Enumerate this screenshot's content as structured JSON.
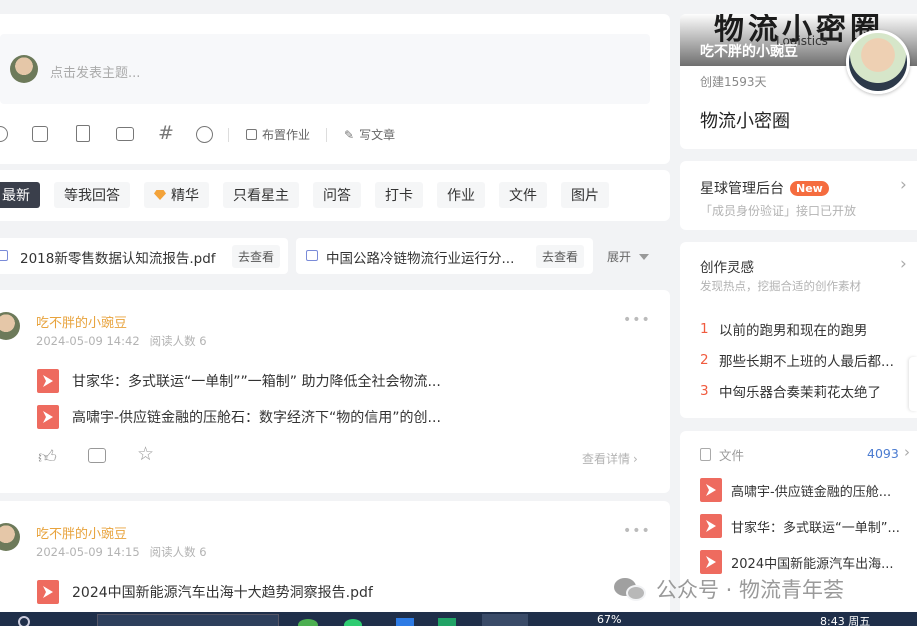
{
  "composer": {
    "placeholder": "点击发表主题...",
    "assign_label": "布置作业",
    "article_label": "写文章"
  },
  "filters": {
    "items": [
      "最新",
      "等我回答",
      "精华",
      "只看星主",
      "问答",
      "打卡",
      "作业",
      "文件",
      "图片"
    ]
  },
  "pinned": {
    "files": [
      "2018新零售数据认知流报告.pdf",
      "中国公路冷链物流行业运行分..."
    ],
    "view_label": "去查看",
    "expand_label": "展开"
  },
  "posts": [
    {
      "author": "吃不胖的小豌豆",
      "time": "2024-05-09 14:42",
      "reads": "阅读人数 6",
      "files": [
        "甘家华：多式联运“一单制””一箱制” 助力降低全社会物流...",
        "高啸宇-供应链金融的压舱石：数字经济下“物的信用”的创..."
      ],
      "detail_label": "查看详情"
    },
    {
      "author": "吃不胖的小豌豆",
      "time": "2024-05-09 14:15",
      "reads": "阅读人数 6",
      "files": [
        "2024中国新能源汽车出海十大趋势洞察报告.pdf"
      ]
    }
  ],
  "sidebar": {
    "banner_text": "物流小密圈",
    "banner_sub": "Logistics",
    "owner": "吃不胖的小豌豆",
    "created": "创建1593天",
    "group_name": "物流小密圈",
    "admin": {
      "title": "星球管理后台",
      "badge": "New",
      "sub": "「成员身份验证」接口已开放"
    },
    "inspiration": {
      "title": "创作灵感",
      "sub": "发现热点，挖掘合适的创作素材",
      "items": [
        {
          "rank": "1",
          "text": "以前的跑男和现在的跑男"
        },
        {
          "rank": "2",
          "text": "那些长期不上班的人最后都..."
        },
        {
          "rank": "3",
          "text": "中匈乐器合奏茉莉花太绝了"
        }
      ]
    },
    "files": {
      "title": "文件",
      "count": "4093",
      "items": [
        "高啸宇-供应链金融的压舱...",
        "甘家华：多式联运“一单制”...",
        "2024中国新能源汽车出海..."
      ]
    }
  },
  "watermark": "公众号 · 物流青年荟",
  "taskbar": {
    "battery": "67%",
    "time": "8:43 周五"
  },
  "colors": {
    "accent": "#e8a33d",
    "badge": "#f56c3f",
    "pdf": "#ee6b5f",
    "rank": "#f05b3f",
    "link": "#4a7bd0"
  }
}
